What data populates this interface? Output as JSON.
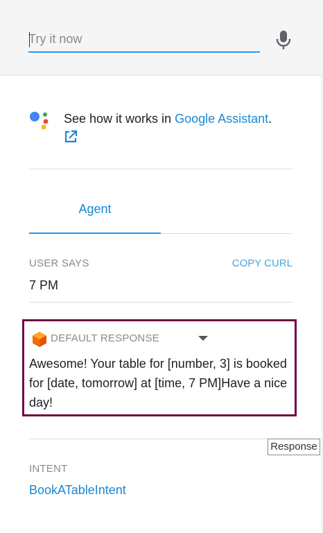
{
  "test_console": {
    "input_placeholder": "Try it now",
    "mic_icon": "microphone-icon"
  },
  "assistant": {
    "text_prefix": "See how it works in ",
    "link_label": "Google Assistant",
    "text_suffix": ".",
    "logo": "google-assistant-logo",
    "external_icon": "external-link-icon"
  },
  "tabs": [
    {
      "label": "Agent",
      "active": true
    }
  ],
  "user_says": {
    "label": "USER SAYS",
    "copy_curl_label": "COPY CURL",
    "value": "7 PM"
  },
  "default_response": {
    "label": "DEFAULT RESPONSE",
    "icon": "dialogflow-icon",
    "text": "Awesome! Your table for [number, 3] is booked for [date, tomorrow] at [time, 7 PM]Have a nice day!",
    "highlight_color": "#6e0a3e"
  },
  "tooltip": {
    "text": "Response"
  },
  "intent": {
    "label": "INTENT",
    "value": "BookATableIntent"
  },
  "colors": {
    "accent": "#2196f3",
    "link": "#1a88d4"
  }
}
